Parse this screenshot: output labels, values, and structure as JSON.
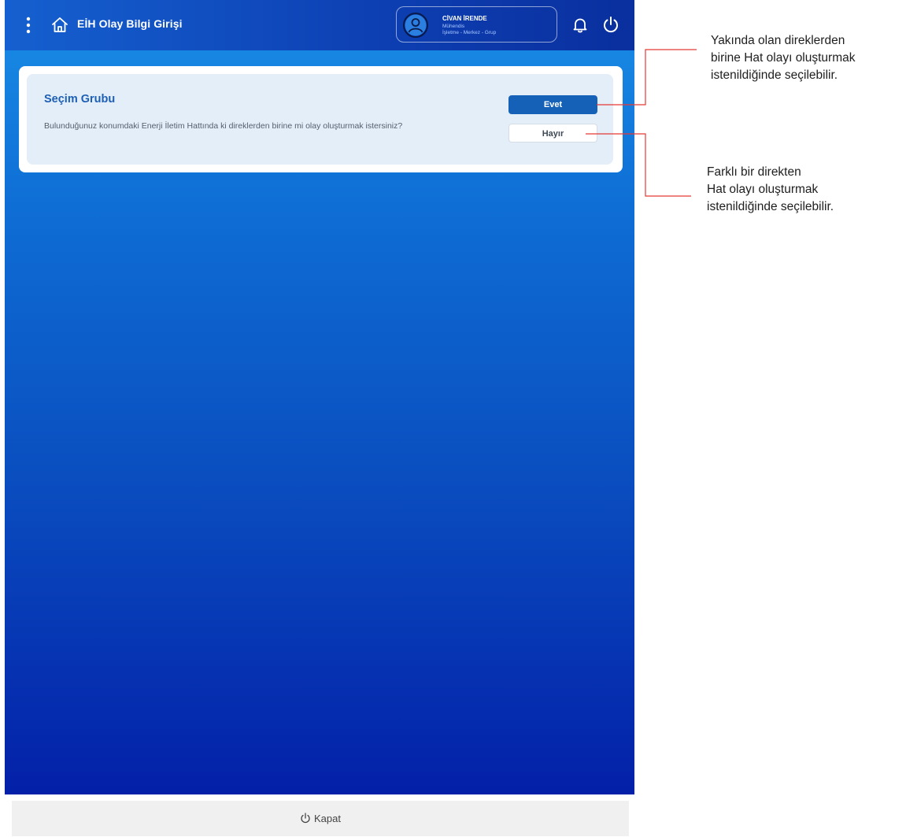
{
  "header": {
    "title": "EİH Olay Bilgi Girişi",
    "menu_icon": "vertical-dots-icon",
    "home_icon": "home-icon",
    "user": {
      "name": "CİVAN İRENDE",
      "role": "Mühendis",
      "org": "İşletme - Merkez - Grup"
    },
    "bell_icon": "bell-icon",
    "power_icon": "power-icon"
  },
  "card": {
    "title": "Seçim Grubu",
    "question": "Bulunduğunuz konumdaki Enerji İletim Hattında ki direklerden birine mi olay oluşturmak istersiniz?",
    "yes_label": "Evet",
    "no_label": "Hayır"
  },
  "footer": {
    "close_label": "Kapat",
    "close_icon": "power-icon"
  },
  "annotations": {
    "yes_line1": "Yakında olan direklerden",
    "yes_line2": "birine Hat olayı oluşturmak",
    "yes_line3": "istenildiğinde seçilebilir.",
    "no_line1": "Farklı bir direkten",
    "no_line2": "Hat olayı oluşturmak",
    "no_line3": "istenildiğinde seçilebilir.",
    "line_color": "#e53935"
  },
  "colors": {
    "primary_button": "#1561b8",
    "title_blue": "#1d5fb5",
    "card_bg": "#e3eef9"
  }
}
